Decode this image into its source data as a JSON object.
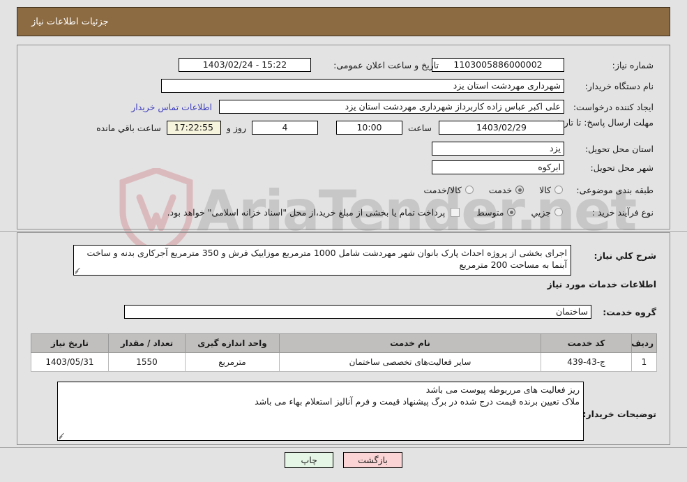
{
  "header": {
    "title": "جزئیات اطلاعات نیاز"
  },
  "fields": {
    "need_number_label": "شماره نیاز:",
    "need_number_value": "1103005886000002",
    "announce_datetime_label": "تاریخ و ساعت اعلان عمومی:",
    "announce_datetime_value": "15:22 - 1403/02/24",
    "buyer_org_label": "نام دستگاه خریدار:",
    "buyer_org_value": "شهرداری مهردشت استان یزد",
    "requester_label": "ایجاد کننده درخواست:",
    "requester_value": "علی اکبر عباس زاده کاربرداز شهرداری مهردشت استان یزد",
    "buyer_contact_link": "اطلاعات تماس خریدار",
    "deadline_label": "مهلت ارسال پاسخ: تا تاریخ:",
    "deadline_date_value": "1403/02/29",
    "time_label": "ساعت",
    "time_value": "10:00",
    "days_value": "4",
    "days_suffix": "روز و",
    "countdown_value": "17:22:55",
    "countdown_suffix": "ساعت باقي مانده",
    "province_label": "استان محل تحویل:",
    "province_value": "یزد",
    "city_label": "شهر محل تحویل:",
    "city_value": "ابرکوه",
    "category_label": "طبقه بندی موضوعی:",
    "process_type_label": "نوع فرآیند خرید :",
    "treasury_note": "پرداخت تمام یا بخشی از مبلغ خرید،از محل \"اسناد خزانه اسلامی\" خواهد بود."
  },
  "category_options": [
    {
      "label": "کالا",
      "selected": false
    },
    {
      "label": "خدمت",
      "selected": true
    },
    {
      "label": "کالا/خدمت",
      "selected": false
    }
  ],
  "process_options": [
    {
      "label": "جزیي",
      "selected": false
    },
    {
      "label": "متوسط",
      "selected": true
    }
  ],
  "description": {
    "label": "شرح کلي نیاز:",
    "value": "اجرای بخشی از پروژه احداث پارک بانوان شهر مهردشت شامل 1000 مترمربع موزاییک فرش و 350 مترمربع آجرکاری بدنه و ساخت آبنما به مساحت 200 مترمربع"
  },
  "services_section": {
    "heading": "اطلاعات خدمات مورد نیاز",
    "group_label": "گروه خدمت:",
    "group_value": "ساختمان"
  },
  "table": {
    "columns": [
      "ردیف",
      "کد خدمت",
      "نام خدمت",
      "واحد اندازه گیری",
      "تعداد / مقدار",
      "تاریخ نیاز"
    ],
    "rows": [
      {
        "index": "1",
        "code": "ج-43-439",
        "name": "سایر فعالیت‌های تخصصی ساختمان",
        "unit": "مترمربع",
        "quantity": "1550",
        "need_date": "1403/05/31"
      }
    ]
  },
  "buyer_notes": {
    "label": "توضیحات خریدار:",
    "line1": "ریز فعالیت های مرربوطه پیوست می باشد",
    "line2": "ملاک تعیین برنده قیمت درج شده در برگ پیشنهاد قیمت و فرم آنالیز استعلام بهاء می باشد"
  },
  "buttons": {
    "print": "چاپ",
    "back": "بازگشت"
  },
  "watermark": {
    "text": "AriaTender.net"
  },
  "colors": {
    "header_bg": "#8c6b42",
    "page_bg": "#e3e3e3",
    "link": "#4040c0",
    "table_header_bg": "#c0bfbd",
    "print_btn": "#e6f6e6",
    "back_btn": "#fbd5d5",
    "countdown_bg": "#f7f4dd"
  }
}
